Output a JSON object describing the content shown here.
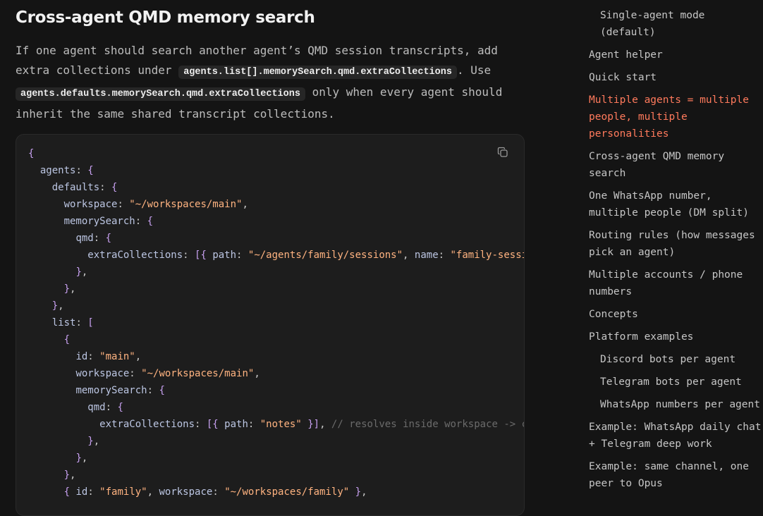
{
  "heading": "Cross-agent QMD memory search",
  "paragraph": {
    "t1": "If one agent should search another agent’s QMD session transcripts, add extra collections under ",
    "code1": "agents.list[].memorySearch.qmd.extraCollections",
    "t2": ". Use ",
    "code2": "agents.defaults.memorySearch.qmd.extraCollections",
    "t3": " only when every agent should inherit the same shared transcript collections."
  },
  "code_lines": [
    [
      [
        "p",
        "{"
      ]
    ],
    [
      [
        "w",
        "  "
      ],
      [
        "k",
        "agents"
      ],
      [
        "w",
        ": "
      ],
      [
        "p",
        "{"
      ]
    ],
    [
      [
        "w",
        "    "
      ],
      [
        "k",
        "defaults"
      ],
      [
        "w",
        ": "
      ],
      [
        "p",
        "{"
      ]
    ],
    [
      [
        "w",
        "      "
      ],
      [
        "k",
        "workspace"
      ],
      [
        "w",
        ": "
      ],
      [
        "s",
        "\"~/workspaces/main\""
      ],
      [
        "w",
        ","
      ]
    ],
    [
      [
        "w",
        "      "
      ],
      [
        "k",
        "memorySearch"
      ],
      [
        "w",
        ": "
      ],
      [
        "p",
        "{"
      ]
    ],
    [
      [
        "w",
        "        "
      ],
      [
        "k",
        "qmd"
      ],
      [
        "w",
        ": "
      ],
      [
        "p",
        "{"
      ]
    ],
    [
      [
        "w",
        "          "
      ],
      [
        "k",
        "extraCollections"
      ],
      [
        "w",
        ": "
      ],
      [
        "p",
        "[{"
      ],
      [
        "w",
        " "
      ],
      [
        "k",
        "path"
      ],
      [
        "w",
        ": "
      ],
      [
        "s",
        "\"~/agents/family/sessions\""
      ],
      [
        "w",
        ", "
      ],
      [
        "k",
        "name"
      ],
      [
        "w",
        ": "
      ],
      [
        "s",
        "\"family-sessions\""
      ],
      [
        "w",
        " "
      ],
      [
        "p",
        "}]"
      ],
      [
        "w",
        ","
      ]
    ],
    [
      [
        "w",
        "        "
      ],
      [
        "p",
        "}"
      ],
      [
        "w",
        ","
      ]
    ],
    [
      [
        "w",
        "      "
      ],
      [
        "p",
        "}"
      ],
      [
        "w",
        ","
      ]
    ],
    [
      [
        "w",
        "    "
      ],
      [
        "p",
        "}"
      ],
      [
        "w",
        ","
      ]
    ],
    [
      [
        "w",
        "    "
      ],
      [
        "k",
        "list"
      ],
      [
        "w",
        ": "
      ],
      [
        "p",
        "["
      ]
    ],
    [
      [
        "w",
        "      "
      ],
      [
        "p",
        "{"
      ]
    ],
    [
      [
        "w",
        "        "
      ],
      [
        "k",
        "id"
      ],
      [
        "w",
        ": "
      ],
      [
        "s",
        "\"main\""
      ],
      [
        "w",
        ","
      ]
    ],
    [
      [
        "w",
        "        "
      ],
      [
        "k",
        "workspace"
      ],
      [
        "w",
        ": "
      ],
      [
        "s",
        "\"~/workspaces/main\""
      ],
      [
        "w",
        ","
      ]
    ],
    [
      [
        "w",
        "        "
      ],
      [
        "k",
        "memorySearch"
      ],
      [
        "w",
        ": "
      ],
      [
        "p",
        "{"
      ]
    ],
    [
      [
        "w",
        "          "
      ],
      [
        "k",
        "qmd"
      ],
      [
        "w",
        ": "
      ],
      [
        "p",
        "{"
      ]
    ],
    [
      [
        "w",
        "            "
      ],
      [
        "k",
        "extraCollections"
      ],
      [
        "w",
        ": "
      ],
      [
        "p",
        "[{"
      ],
      [
        "w",
        " "
      ],
      [
        "k",
        "path"
      ],
      [
        "w",
        ": "
      ],
      [
        "s",
        "\"notes\""
      ],
      [
        "w",
        " "
      ],
      [
        "p",
        "}]"
      ],
      [
        "w",
        ", "
      ],
      [
        "c",
        "// resolves inside workspace -> collection"
      ]
    ],
    [
      [
        "w",
        "          "
      ],
      [
        "p",
        "}"
      ],
      [
        "w",
        ","
      ]
    ],
    [
      [
        "w",
        "        "
      ],
      [
        "p",
        "}"
      ],
      [
        "w",
        ","
      ]
    ],
    [
      [
        "w",
        "      "
      ],
      [
        "p",
        "}"
      ],
      [
        "w",
        ","
      ]
    ],
    [
      [
        "w",
        "      "
      ],
      [
        "p",
        "{"
      ],
      [
        "w",
        " "
      ],
      [
        "k",
        "id"
      ],
      [
        "w",
        ": "
      ],
      [
        "s",
        "\"family\""
      ],
      [
        "w",
        ", "
      ],
      [
        "k",
        "workspace"
      ],
      [
        "w",
        ": "
      ],
      [
        "s",
        "\"~/workspaces/family\""
      ],
      [
        "w",
        " "
      ],
      [
        "p",
        "}"
      ],
      [
        "w",
        ","
      ]
    ]
  ],
  "toc": [
    {
      "label": "Single-agent mode\n(default)",
      "sub": true,
      "active": false
    },
    {
      "label": "Agent helper",
      "sub": false,
      "active": false
    },
    {
      "label": "Quick start",
      "sub": false,
      "active": false
    },
    {
      "label": "Multiple agents = multiple\npeople, multiple\npersonalities",
      "sub": false,
      "active": true
    },
    {
      "label": "Cross-agent QMD memory\nsearch",
      "sub": false,
      "active": false
    },
    {
      "label": "One WhatsApp number,\nmultiple people (DM split)",
      "sub": false,
      "active": false
    },
    {
      "label": "Routing rules (how messages\npick an agent)",
      "sub": false,
      "active": false
    },
    {
      "label": "Multiple accounts / phone\nnumbers",
      "sub": false,
      "active": false
    },
    {
      "label": "Concepts",
      "sub": false,
      "active": false
    },
    {
      "label": "Platform examples",
      "sub": false,
      "active": false
    },
    {
      "label": "Discord bots per agent",
      "sub": true,
      "active": false
    },
    {
      "label": "Telegram bots per agent",
      "sub": true,
      "active": false
    },
    {
      "label": "WhatsApp numbers per agent",
      "sub": true,
      "active": false
    },
    {
      "label": "Example: WhatsApp daily chat\n+ Telegram deep work",
      "sub": false,
      "active": false
    },
    {
      "label": "Example: same channel, one\npeer to Opus",
      "sub": false,
      "active": false
    }
  ],
  "icons": {
    "copy": "copy-icon"
  }
}
